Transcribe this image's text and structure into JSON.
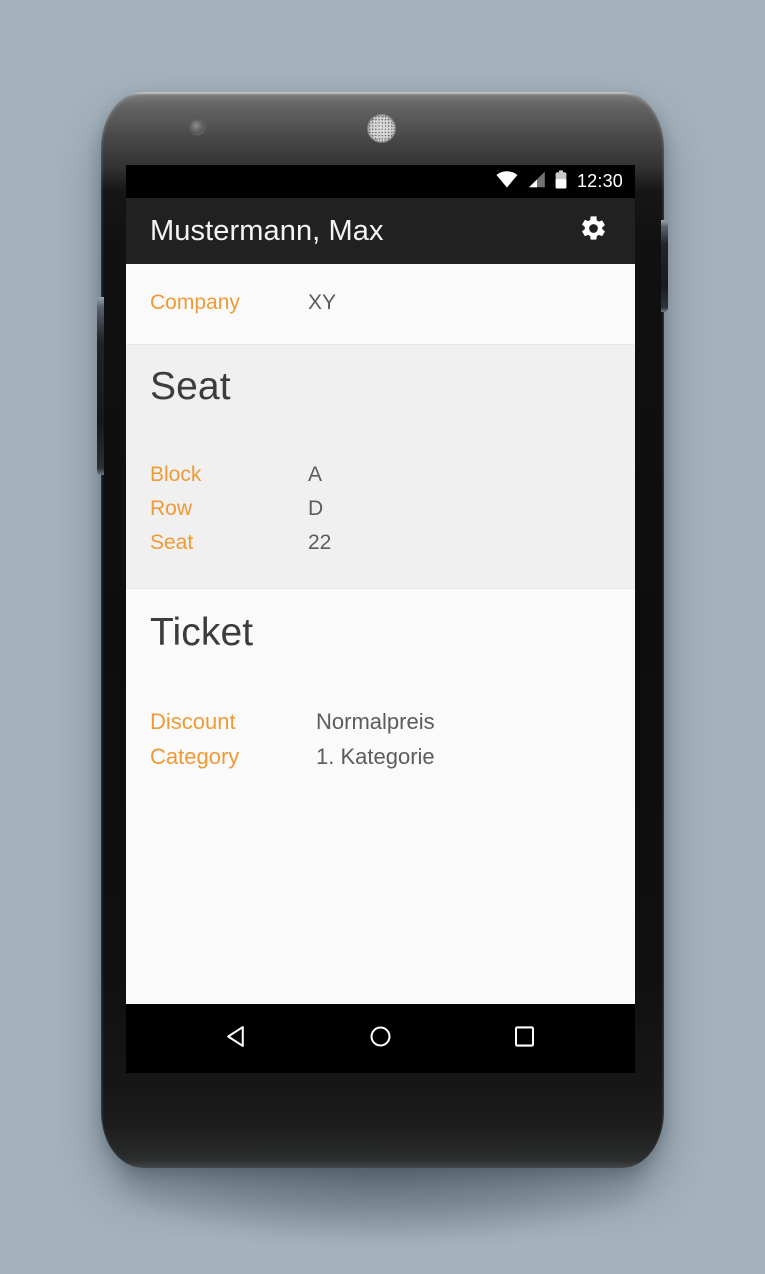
{
  "device": {
    "camera_icon": "front-camera-icon",
    "earpiece_icon": "earpiece-speaker-icon"
  },
  "status_bar": {
    "wifi_icon": "wifi-icon",
    "signal_icon": "cellular-signal-icon",
    "battery_icon": "battery-icon",
    "clock": "12:30"
  },
  "action_bar": {
    "title": "Mustermann, Max",
    "settings_icon": "gear-icon"
  },
  "content": {
    "company_row": {
      "label": "Company",
      "value": "XY"
    },
    "seat_section": {
      "heading": "Seat",
      "rows": [
        {
          "label": "Block",
          "value": "A"
        },
        {
          "label": "Row",
          "value": "D"
        },
        {
          "label": "Seat",
          "value": "22"
        }
      ]
    },
    "ticket_section": {
      "heading": "Ticket",
      "rows": [
        {
          "label": "Discount",
          "value": "Normalpreis"
        },
        {
          "label": "Category",
          "value": "1. Kategorie"
        }
      ]
    }
  },
  "nav_bar": {
    "back_icon": "back-triangle-icon",
    "home_icon": "home-circle-icon",
    "recents_icon": "recents-square-icon"
  },
  "colors": {
    "accent_orange": "#f09a35",
    "action_bar_bg": "#212121",
    "status_bar_bg": "#000000",
    "card_light": "#fafafa",
    "card_grey": "#f0f0f0",
    "value_text": "#5c5c5c",
    "heading_text": "#3c3c3c",
    "page_background": "#a4b2bc"
  }
}
